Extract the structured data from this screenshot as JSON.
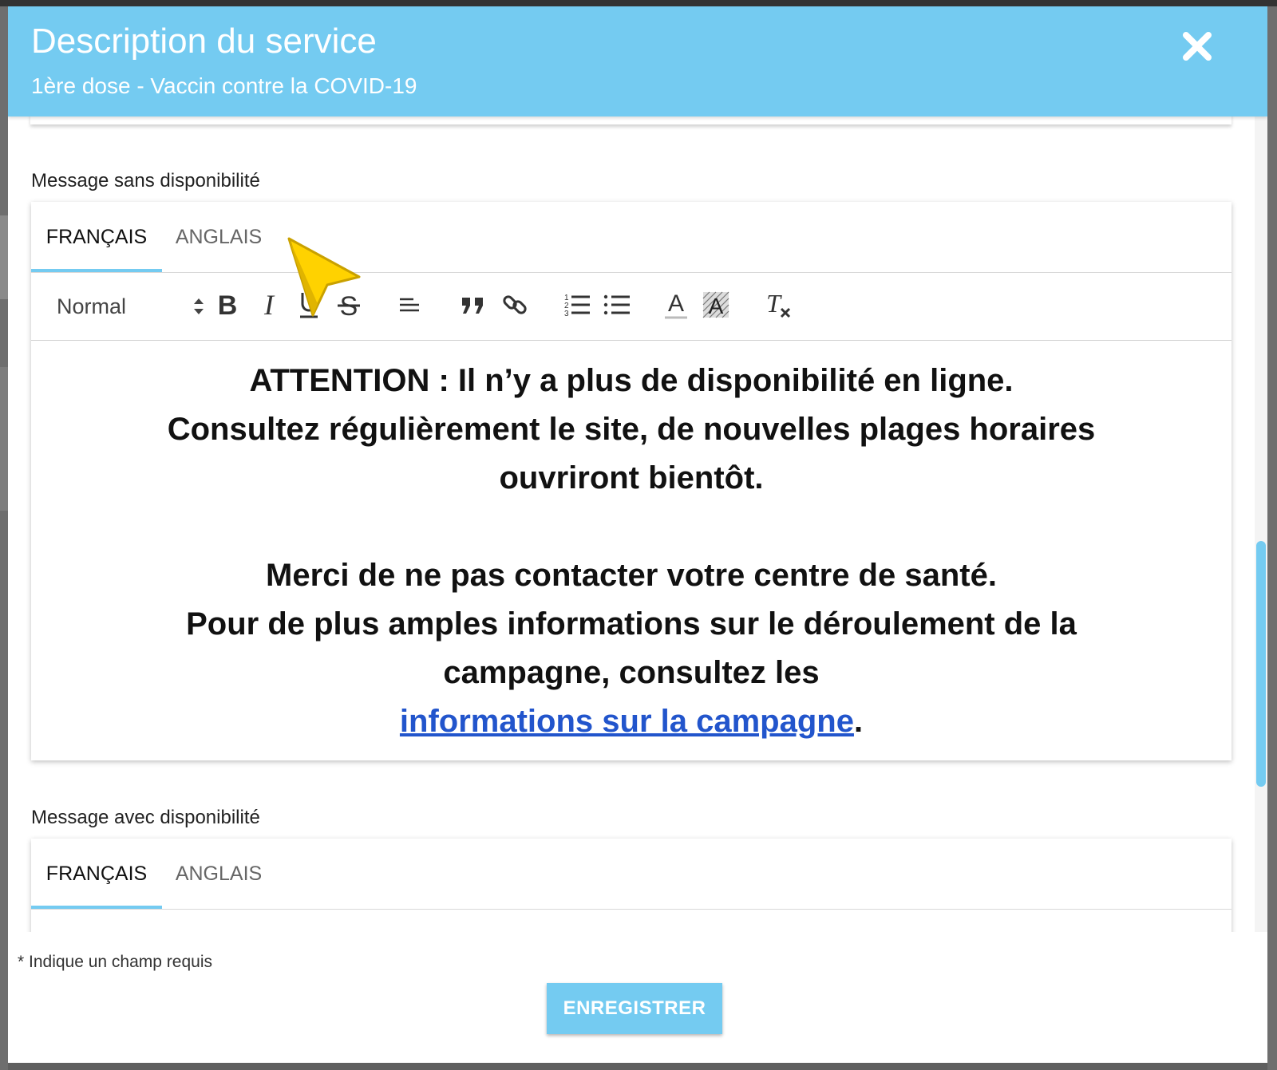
{
  "modal": {
    "title": "Description du service",
    "subtitle": "1ère dose - Vaccin contre la COVID-19",
    "close_icon": "close-icon"
  },
  "sections": [
    {
      "label": "Message sans disponibilité",
      "tabs": [
        "FRANÇAIS",
        "ANGLAIS"
      ],
      "active_tab": "FRANÇAIS",
      "toolbar": {
        "header_select": "Normal",
        "buttons": [
          "bold-icon",
          "italic-icon",
          "underline-icon",
          "strikethrough-icon",
          "align-icon",
          "blockquote-icon",
          "link-icon",
          "ordered-list-icon",
          "bullet-list-icon",
          "text-color-icon",
          "background-color-icon",
          "clear-format-icon"
        ]
      },
      "content": {
        "line1": "ATTENTION : Il n’y a plus de disponibilité en ligne.",
        "line2": "Consultez régulièrement le site, de nouvelles plages horaires ouvriront bientôt.",
        "line3": "Merci de ne pas contacter votre centre de santé.",
        "line4": "Pour de plus amples informations sur le déroulement de la campagne, consultez les",
        "link_text": "informations sur la campagne",
        "link_suffix": "."
      }
    },
    {
      "label": "Message avec disponibilité",
      "tabs": [
        "FRANÇAIS",
        "ANGLAIS"
      ],
      "active_tab": "FRANÇAIS"
    }
  ],
  "footer": {
    "required_note": "* Indique un champ requis",
    "save_label": "ENREGISTRER"
  },
  "colors": {
    "header": "#74cbf1",
    "link": "#2255cc",
    "save_button": "#74cbf1"
  }
}
